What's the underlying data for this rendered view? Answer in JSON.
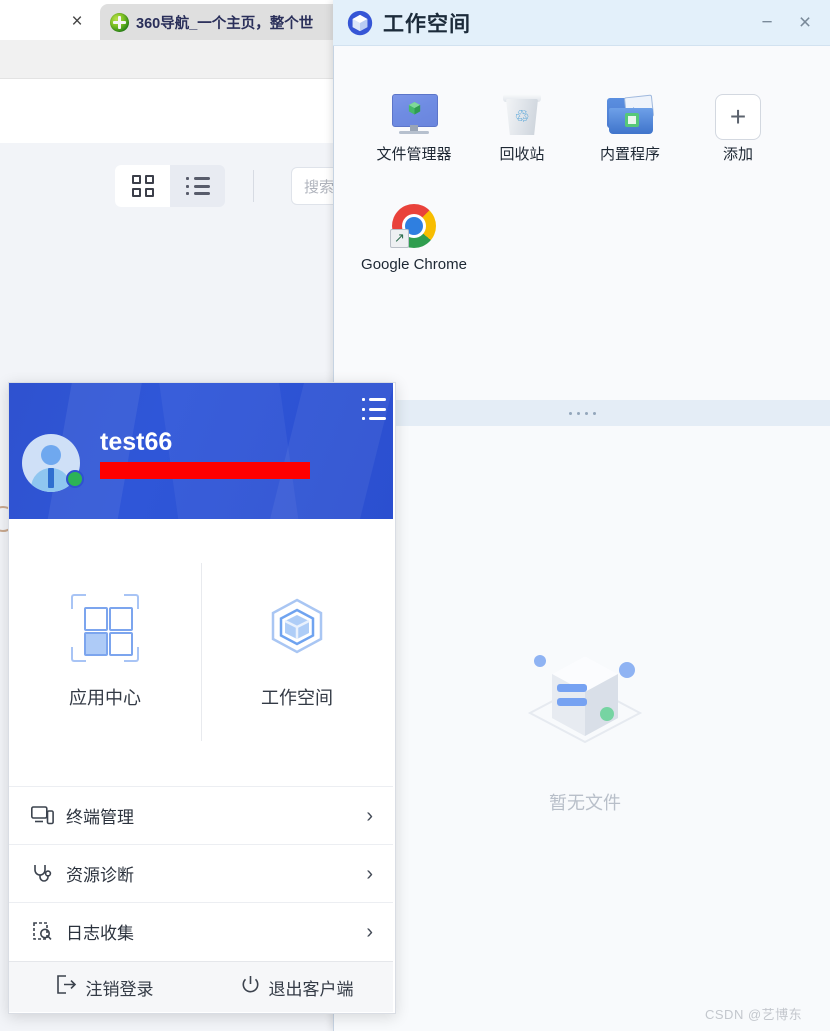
{
  "browser": {
    "tab": {
      "title": "360导航_一个主页，整个世",
      "favicon": "360-logo-icon",
      "close_label": "×"
    },
    "translate_icon": "translate-icon",
    "toolbar": {
      "grid_view_icon": "grid-view-icon",
      "list_view_icon": "list-view-icon",
      "search_placeholder": "搜索"
    }
  },
  "workspace_window": {
    "title": "工作空间",
    "app_icon": "cube-icon",
    "minimize_label": "−",
    "close_label": "×",
    "desktop_icons": [
      {
        "label": "文件管理器",
        "icon": "monitor-cube-icon"
      },
      {
        "label": "回收站",
        "icon": "recycle-bin-icon"
      },
      {
        "label": "内置程序",
        "icon": "folder-image-icon"
      },
      {
        "label": "添加",
        "icon": "plus-icon",
        "plus": "+"
      },
      {
        "label": "Google Chrome",
        "icon": "chrome-icon"
      }
    ],
    "splitter": "drag-handle",
    "empty_state": {
      "caption": "暂无文件",
      "illustration": "empty-box-illustration"
    }
  },
  "client_panel": {
    "username": "test66",
    "redacted_field": "",
    "menu_icon": "hamburger-menu-icon",
    "avatar": "user-avatar",
    "status": "online",
    "shortcuts": [
      {
        "label": "应用中心",
        "icon": "app-center-icon"
      },
      {
        "label": "工作空间",
        "icon": "workspace-hexcube-icon"
      }
    ],
    "menu_items": [
      {
        "label": "终端管理",
        "icon": "terminal-management-icon",
        "chevron": "›"
      },
      {
        "label": "资源诊断",
        "icon": "stethoscope-icon",
        "chevron": "›"
      },
      {
        "label": "日志收集",
        "icon": "log-clipboard-icon",
        "chevron": "›"
      }
    ],
    "footer": [
      {
        "label": "注销登录",
        "icon": "logout-icon"
      },
      {
        "label": "退出客户端",
        "icon": "power-icon"
      }
    ]
  },
  "watermark": "CSDN @艺博东",
  "colors": {
    "client_brand": "#2f52cf",
    "title_bar": "#e3f0fa",
    "redaction": "#fe0000",
    "accent_orange": "#f5822c"
  }
}
